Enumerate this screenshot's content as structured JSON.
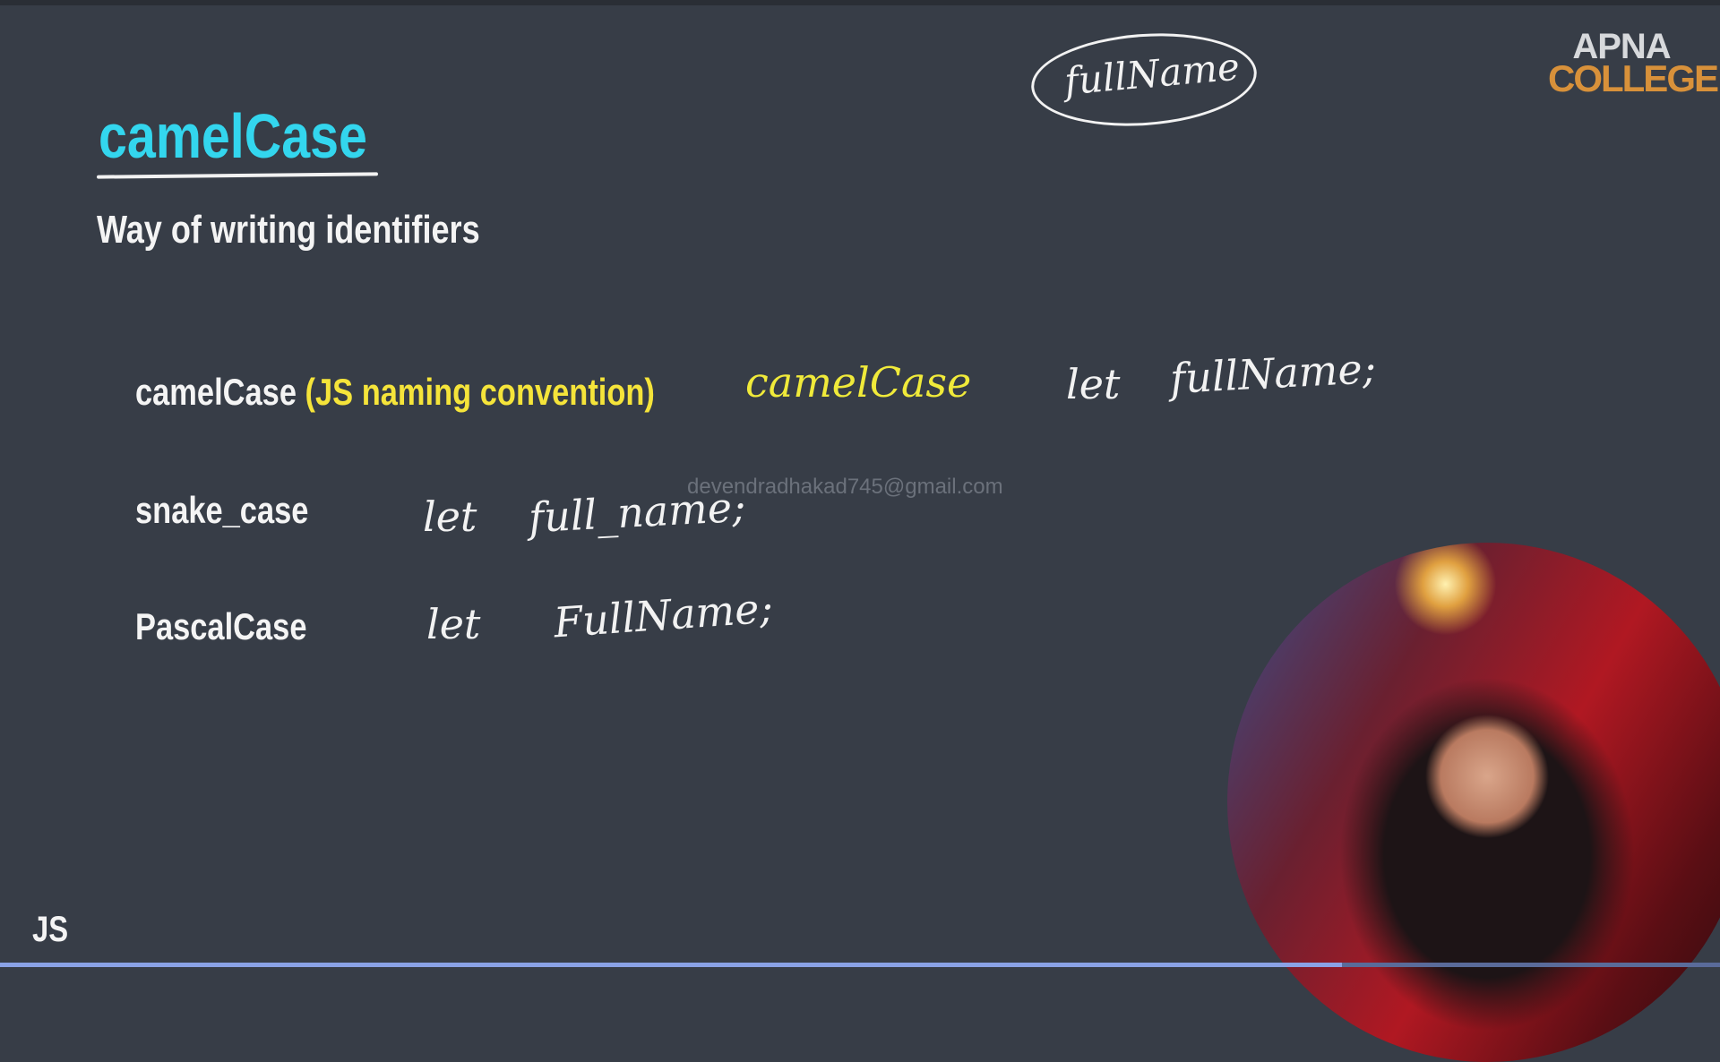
{
  "slide": {
    "title": "camelCase",
    "subtitle": "Way of writing identifiers",
    "rows": [
      {
        "label": "camelCase",
        "note": "(JS naming convention)",
        "hand_yellow": "camelCase",
        "hand_let": "let",
        "hand_code": "fullName;"
      },
      {
        "label": "snake_case",
        "hand_let": "let",
        "hand_code": "full_name;"
      },
      {
        "label": "PascalCase",
        "hand_let": "let",
        "hand_code": "FullName;"
      }
    ],
    "circled_annotation": "fullName",
    "footer_label": "JS"
  },
  "logo": {
    "line1": "APNA",
    "line2": "COLLEGE",
    "colors": {
      "line1": "#d7d9dc",
      "line2": "#d8913a"
    }
  },
  "watermark": "devendradhakad745@gmail.com",
  "colors": {
    "background": "#373d47",
    "title": "#33d6ee",
    "highlight": "#f5e43a"
  },
  "video": {
    "progress_percent": 78
  }
}
